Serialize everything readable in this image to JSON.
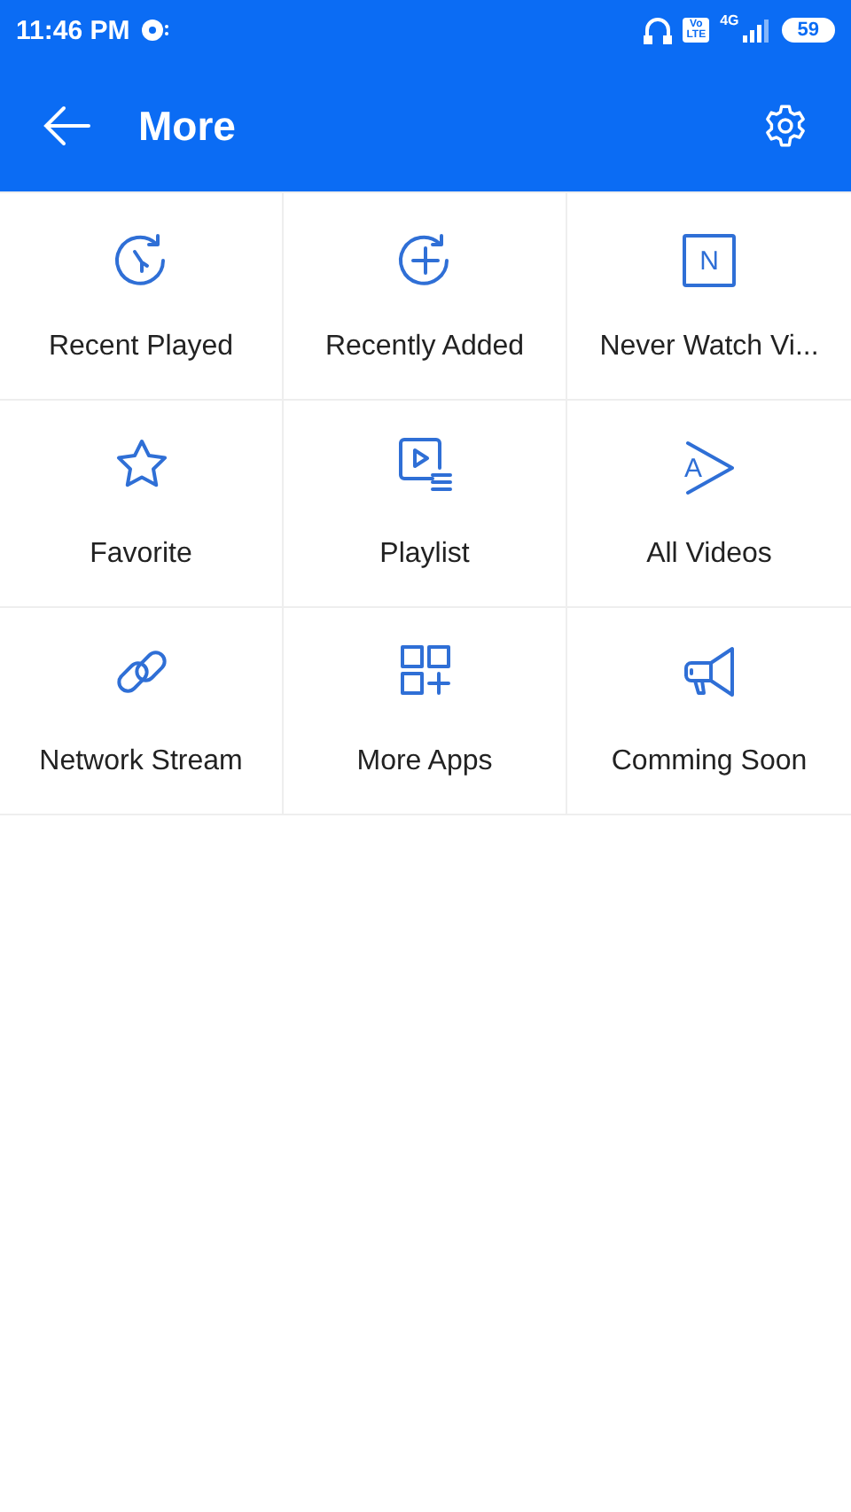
{
  "status_bar": {
    "time": "11:46 PM",
    "volte": [
      "Vo",
      "LTE"
    ],
    "network": "4G",
    "battery": "59"
  },
  "app_bar": {
    "title": "More"
  },
  "items": [
    {
      "label": "Recent Played",
      "kind": "clock"
    },
    {
      "label": "Recently Added",
      "kind": "add"
    },
    {
      "label": "Never Watch Vi...",
      "kind": "letterbox",
      "glyph": "N"
    },
    {
      "label": "Favorite",
      "kind": "star"
    },
    {
      "label": "Playlist",
      "kind": "playlist"
    },
    {
      "label": "All Videos",
      "kind": "lettertriangle",
      "glyph": "A"
    },
    {
      "label": "Network Stream",
      "kind": "link"
    },
    {
      "label": "More Apps",
      "kind": "apps"
    },
    {
      "label": "Comming Soon",
      "kind": "megaphone"
    }
  ]
}
